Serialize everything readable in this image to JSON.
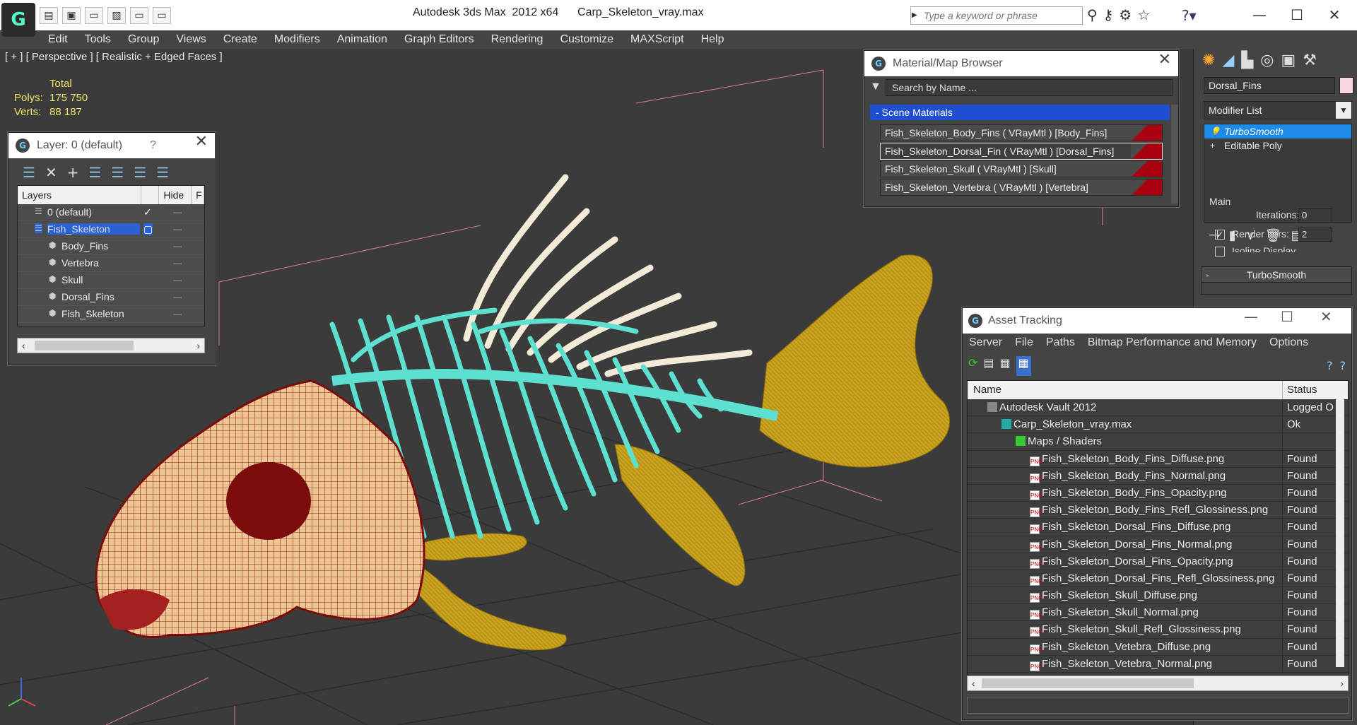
{
  "app": {
    "title": "Autodesk 3ds Max  2012 x64      Carp_Skeleton_vray.max",
    "logo_icon": "3dsmax-logo-icon",
    "search_placeholder": "Type a keyword or phrase",
    "quick_access": [
      "new-icon",
      "open-icon",
      "save-icon",
      "undo-icon",
      "redo-icon",
      "project-icon"
    ]
  },
  "menu": [
    "Edit",
    "Tools",
    "Group",
    "Views",
    "Create",
    "Modifiers",
    "Animation",
    "Graph Editors",
    "Rendering",
    "Customize",
    "MAXScript",
    "Help"
  ],
  "viewport": {
    "label": "[ + ] [ Perspective ] [ Realistic + Edged Faces ]",
    "stats": {
      "header": "Total",
      "polys_label": "Polys:",
      "polys_value": "175 750",
      "verts_label": "Verts:",
      "verts_value": "88 187"
    },
    "colors": {
      "skull": "#e9c08e",
      "skull_wire": "#9a1010",
      "vertebra": "#5ee0d0",
      "fins": "#c9a21e",
      "dorsal": "#f2e6d2"
    }
  },
  "layer_panel": {
    "title": "Layer: 0 (default)",
    "help": "?",
    "columns": {
      "layers": "Layers",
      "hide": "Hide",
      "freeze": "F"
    },
    "rows": [
      {
        "name": "0 (default)",
        "indent": 0
      },
      {
        "name": "Fish_Skeleton",
        "indent": 0
      },
      {
        "name": "Body_Fins",
        "indent": 1
      },
      {
        "name": "Vertebra",
        "indent": 1
      },
      {
        "name": "Skull",
        "indent": 1
      },
      {
        "name": "Dorsal_Fins",
        "indent": 1
      },
      {
        "name": "Fish_Skeleton",
        "indent": 1
      }
    ]
  },
  "material_browser": {
    "title": "Material/Map Browser",
    "search_placeholder": "Search by Name ...",
    "section": "- Scene Materials",
    "items": [
      "Fish_Skeleton_Body_Fins  ( VRayMtl ) [Body_Fins]",
      "Fish_Skeleton_Dorsal_Fin  ( VRayMtl ) [Dorsal_Fins]",
      "Fish_Skeleton_Skull  ( VRayMtl ) [Skull]",
      "Fish_Skeleton_Vertebra  ( VRayMtl ) [Vertebra]"
    ]
  },
  "command_panel": {
    "object_name": "Dorsal_Fins",
    "object_color": "#f9d6e6",
    "modifier_list": "Modifier List",
    "stack": [
      "TurboSmooth",
      "Editable Poly"
    ],
    "rollout_title": "TurboSmooth",
    "group_main": "Main",
    "iterations_label": "Iterations:",
    "iterations_value": "0",
    "render_iters_label": "Render Iters:",
    "render_iters_value": "2",
    "isoline_label": "Isoline Display"
  },
  "asset_tracking": {
    "title": "Asset Tracking",
    "menu": [
      "Server",
      "File",
      "Paths",
      "Bitmap Performance and Memory",
      "Options"
    ],
    "columns": {
      "name": "Name",
      "status": "Status"
    },
    "rows": [
      {
        "name": "Autodesk Vault 2012",
        "status": "Logged O",
        "icon": "vault",
        "indent": 1
      },
      {
        "name": "Carp_Skeleton_vray.max",
        "status": "Ok",
        "icon": "max",
        "indent": 2
      },
      {
        "name": "Maps / Shaders",
        "status": "",
        "icon": "maps",
        "indent": 3
      },
      {
        "name": "Fish_Skeleton_Body_Fins_Diffuse.png",
        "status": "Found",
        "icon": "png",
        "indent": 4
      },
      {
        "name": "Fish_Skeleton_Body_Fins_Normal.png",
        "status": "Found",
        "icon": "png",
        "indent": 4
      },
      {
        "name": "Fish_Skeleton_Body_Fins_Opacity.png",
        "status": "Found",
        "icon": "png",
        "indent": 4
      },
      {
        "name": "Fish_Skeleton_Body_Fins_Refl_Glossiness.png",
        "status": "Found",
        "icon": "png",
        "indent": 4
      },
      {
        "name": "Fish_Skeleton_Dorsal_Fins_Diffuse.png",
        "status": "Found",
        "icon": "png",
        "indent": 4
      },
      {
        "name": "Fish_Skeleton_Dorsal_Fins_Normal.png",
        "status": "Found",
        "icon": "png",
        "indent": 4
      },
      {
        "name": "Fish_Skeleton_Dorsal_Fins_Opacity.png",
        "status": "Found",
        "icon": "png",
        "indent": 4
      },
      {
        "name": "Fish_Skeleton_Dorsal_Fins_Refl_Glossiness.png",
        "status": "Found",
        "icon": "png",
        "indent": 4
      },
      {
        "name": "Fish_Skeleton_Skull_Diffuse.png",
        "status": "Found",
        "icon": "png",
        "indent": 4
      },
      {
        "name": "Fish_Skeleton_Skull_Normal.png",
        "status": "Found",
        "icon": "png",
        "indent": 4
      },
      {
        "name": "Fish_Skeleton_Skull_Refl_Glossiness.png",
        "status": "Found",
        "icon": "png",
        "indent": 4
      },
      {
        "name": "Fish_Skeleton_Vetebra_Diffuse.png",
        "status": "Found",
        "icon": "png",
        "indent": 4
      },
      {
        "name": "Fish_Skeleton_Vetebra_Normal.png",
        "status": "Found",
        "icon": "png",
        "indent": 4
      }
    ]
  }
}
